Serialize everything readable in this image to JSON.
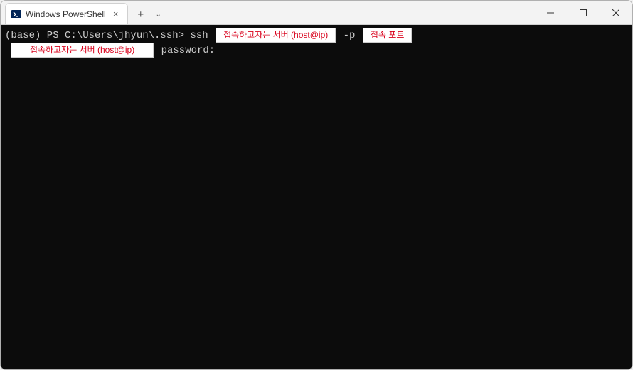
{
  "window": {
    "tab_title": "Windows PowerShell",
    "tab_close_glyph": "×",
    "new_tab_glyph": "+",
    "dropdown_glyph": "⌄",
    "minimize_glyph": "—",
    "maximize_glyph": "▢",
    "close_glyph": "✕"
  },
  "terminal": {
    "line1": {
      "prompt": "(base) PS C:\\Users\\jhyun\\.ssh> ",
      "cmd_part1": "ssh ",
      "annotation_host": "접속하고자는 서버 (host@ip)",
      "flag": " -p ",
      "annotation_port": "접속 포트"
    },
    "line2": {
      "annotation_host2": "접속하고자는 서버 (host@ip)",
      "password_label": " password: "
    }
  },
  "colors": {
    "terminal_bg": "#0c0c0c",
    "terminal_fg": "#cccccc",
    "annotation_fg": "#d9001b"
  }
}
